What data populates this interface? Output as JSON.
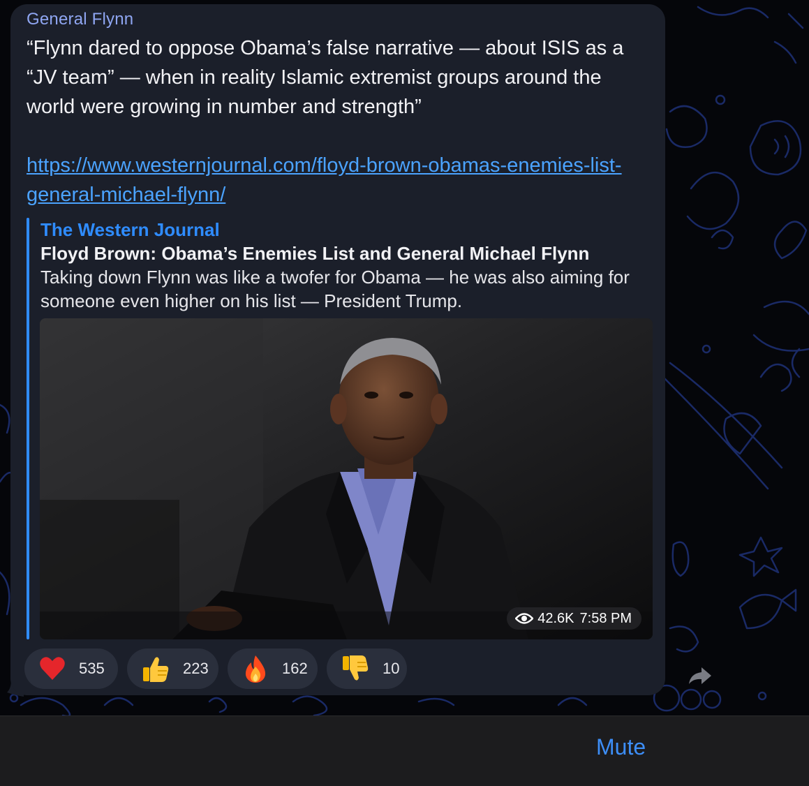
{
  "message": {
    "sender": "General Flynn",
    "text": "“Flynn dared to oppose Obama’s false narrative — about ISIS as a “JV team” — when in reality Islamic extremist groups around the world were growing in number and strength”",
    "link": "https://www.westernjournal.com/floyd-brown-obamas-enemies-list-general-michael-flynn/"
  },
  "preview": {
    "site": "The Western Journal",
    "title": "Floyd Brown: Obama’s Enemies List and General Michael Flynn",
    "description": "Taking down Flynn was like a twofer for Obama — he was also aiming for someone even higher on his list — President Trump.",
    "image_icon": "photo-of-obama",
    "views": "42.6K",
    "time": "7:58 PM"
  },
  "reactions": [
    {
      "icon": "heart-icon",
      "count": "535"
    },
    {
      "icon": "thumbs-up-icon",
      "count": "223"
    },
    {
      "icon": "fire-icon",
      "count": "162"
    },
    {
      "icon": "thumbs-down-icon",
      "count": "10"
    }
  ],
  "footer": {
    "mute_label": "Mute"
  },
  "colors": {
    "accent": "#3d8ef7",
    "sender": "#8fa6f2",
    "bubble": "#1b1f2a"
  }
}
